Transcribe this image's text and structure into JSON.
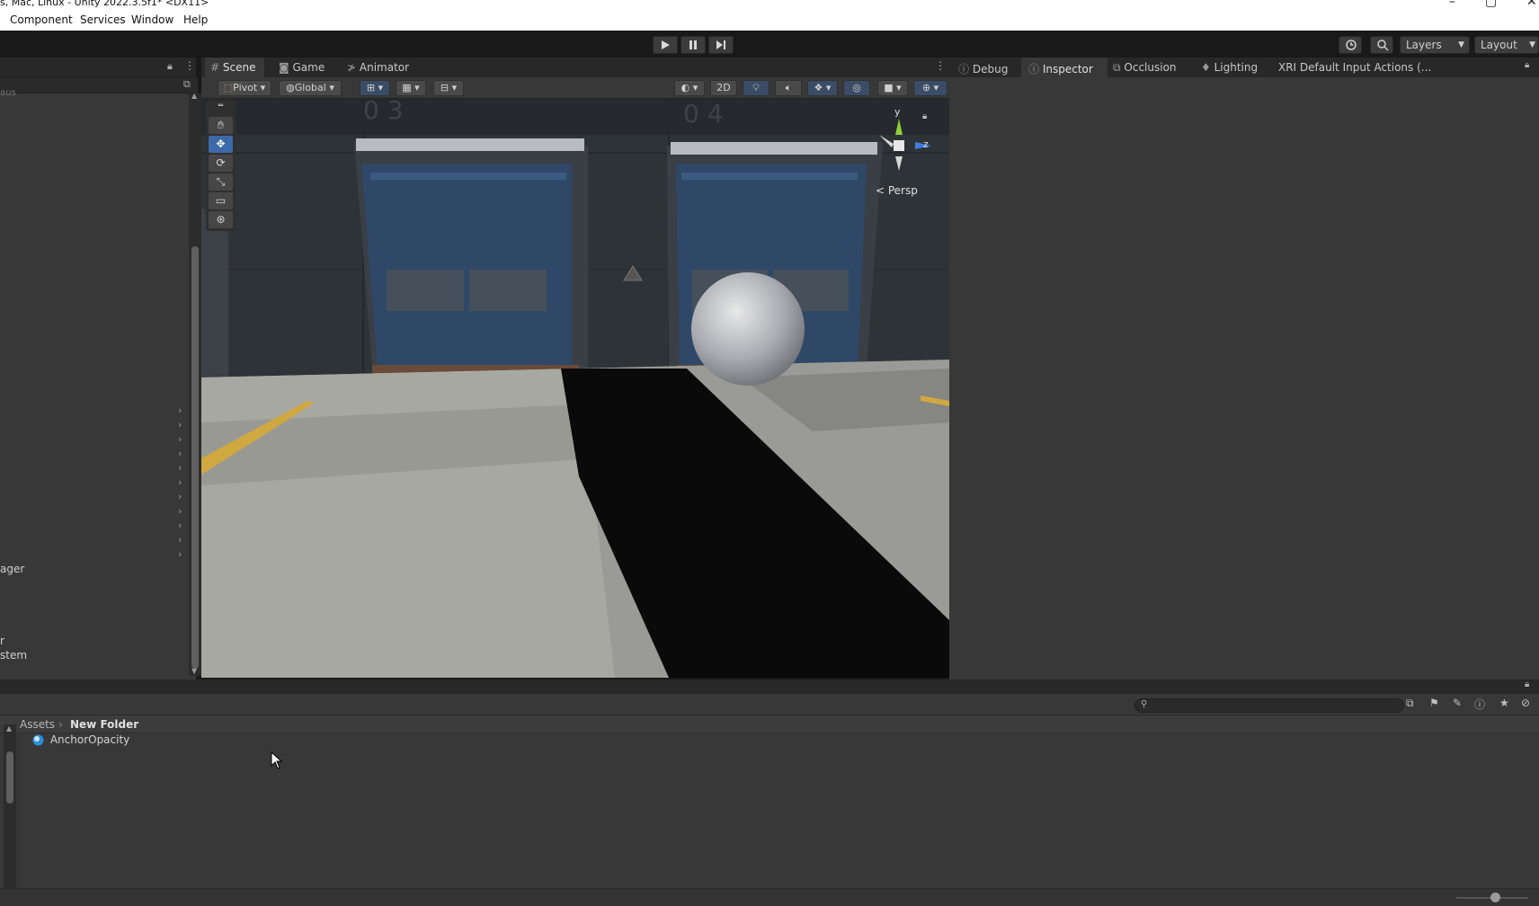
{
  "window": {
    "title": "s, Mac, Linux - Unity 2022.3.5f1* <DX11>"
  },
  "menu": {
    "items": [
      "Component",
      "Services",
      "Window",
      "Help"
    ]
  },
  "toolbar": {
    "play_icon": "play-icon",
    "pause_icon": "pause-icon",
    "step_icon": "step-icon",
    "layers_label": "Layers",
    "layout_label": "Layout"
  },
  "hierarchy": {
    "partial_items": [
      "aus",
      "ager",
      "r",
      "stem"
    ]
  },
  "scene": {
    "tabs": [
      "Scene",
      "Game",
      "Animator"
    ],
    "pivot_label": "Pivot",
    "global_label": "Global",
    "toggle_2d_label": "2D",
    "persp_label": "< Persp",
    "gizmo_axes": {
      "y": "y",
      "z": "z"
    },
    "door_numbers": [
      "0 3",
      "0 4"
    ]
  },
  "inspector": {
    "tabs": [
      "Debug",
      "Inspector",
      "Occlusion",
      "Lighting",
      "XRI Default Input Actions (..."
    ]
  },
  "project": {
    "breadcrumb": [
      "Assets",
      "New Folder"
    ],
    "items": [
      {
        "name": "AnchorOpacity",
        "icon": "material-sphere-icon"
      }
    ]
  },
  "colors": {
    "accent": "#3d6aa8",
    "panel": "#383838",
    "tabbar": "#282828",
    "toolbar": "#191919"
  }
}
